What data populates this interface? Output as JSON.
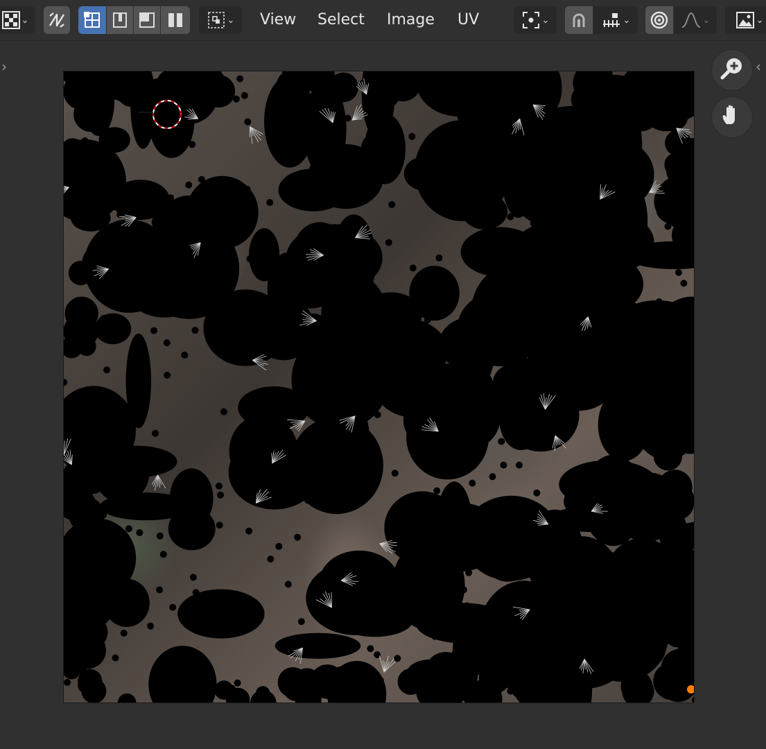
{
  "header": {
    "menu": {
      "view": "View",
      "select": "Select",
      "image": "Image",
      "uv": "UV"
    }
  },
  "toolbar_icons": [
    "checker-editor-type-icon",
    "sync-selection-icon",
    "vertex-select-icon",
    "edge-select-icon",
    "face-select-icon",
    "island-select-icon",
    "sticky-selection-icon",
    "pivot-icon",
    "snap-icon",
    "snap-increment-icon",
    "proportional-editing-icon",
    "falloff-curve-icon",
    "image-browse-icon"
  ],
  "viewport": {
    "nav_icons": [
      "zoom-icon",
      "pan-hand-icon"
    ]
  },
  "colors": {
    "header_bg": "#303030",
    "button_bg": "#545454",
    "button_active": "#4772b3",
    "uv_vertex": "#000000",
    "active_vertex": "#ff8000",
    "cursor_ring": "#cc0000"
  }
}
